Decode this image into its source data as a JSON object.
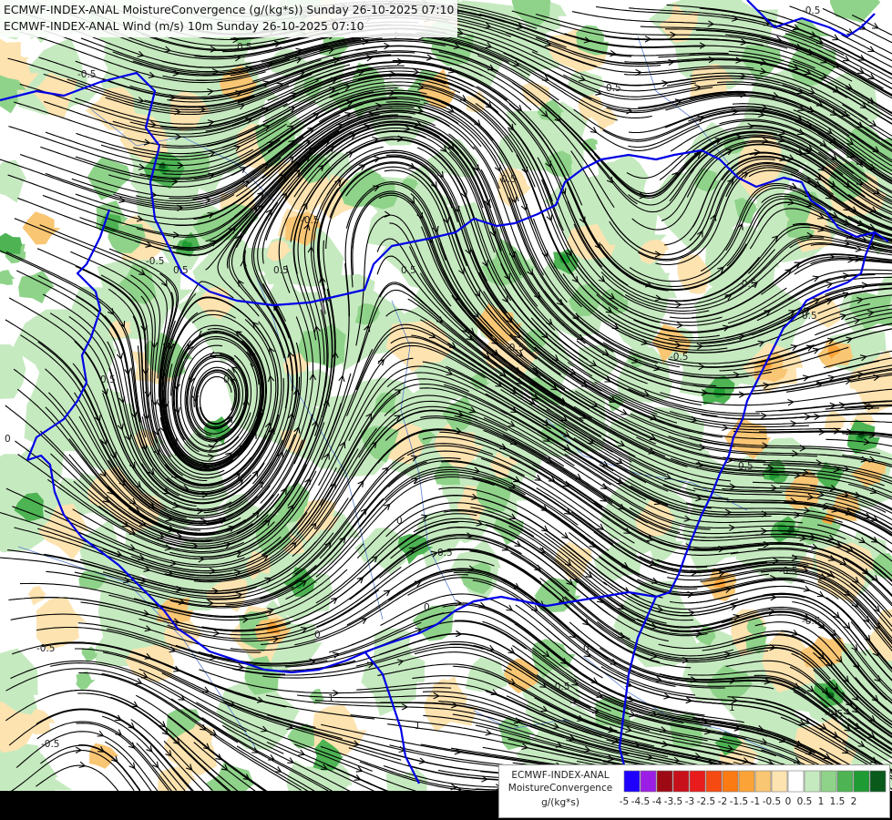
{
  "header": {
    "line1": "ECMWF-INDEX-ANAL MoistureConvergence (g/(kg*s)) Sunday 26-10-2025 07:10",
    "line2": "ECMWF-INDEX-ANAL Wind (m/s) 10m Sunday 26-10-2025 07:10"
  },
  "legend": {
    "line1": "ECMWF-INDEX-ANAL",
    "line2": "MoistureConvergence",
    "line3": "g/(kg*s)",
    "classes": [
      {
        "upper": -5,
        "color": "#1f00ff"
      },
      {
        "upper": -4.5,
        "color": "#9b1ee6"
      },
      {
        "upper": -4,
        "color": "#9d0a14"
      },
      {
        "upper": -3.5,
        "color": "#c8101a"
      },
      {
        "upper": -3,
        "color": "#e81c1c"
      },
      {
        "upper": -2.5,
        "color": "#f54a12"
      },
      {
        "upper": -2,
        "color": "#fb7a14"
      },
      {
        "upper": -1.5,
        "color": "#fca338"
      },
      {
        "upper": -1,
        "color": "#f9c674"
      },
      {
        "upper": -0.5,
        "color": "#fde3b0"
      },
      {
        "upper": 0,
        "color": "#ffffff"
      },
      {
        "upper": 0.5,
        "color": "#c6eac0"
      },
      {
        "upper": 1,
        "color": "#8fd38a"
      },
      {
        "upper": 1.5,
        "color": "#4db353"
      },
      {
        "upper": 2,
        "color": "#1e9b32"
      },
      {
        "upper": 2.5,
        "color": "#0a5a1c"
      }
    ],
    "tick_labels": [
      "-5",
      "-4.5",
      "-4",
      "-3.5",
      "-3",
      "-2.5",
      "-2",
      "-1.5",
      "-1",
      "-0.5",
      "0",
      "0.5",
      "1",
      "1.5",
      "2"
    ]
  },
  "map": {
    "contour_labels": [
      "-0.5",
      "0",
      "0.5",
      "1"
    ],
    "colors": {
      "border": "#0000e6",
      "river": "#5a7fd0",
      "streamline": "#000000",
      "bottom_bar": "#000000"
    }
  }
}
